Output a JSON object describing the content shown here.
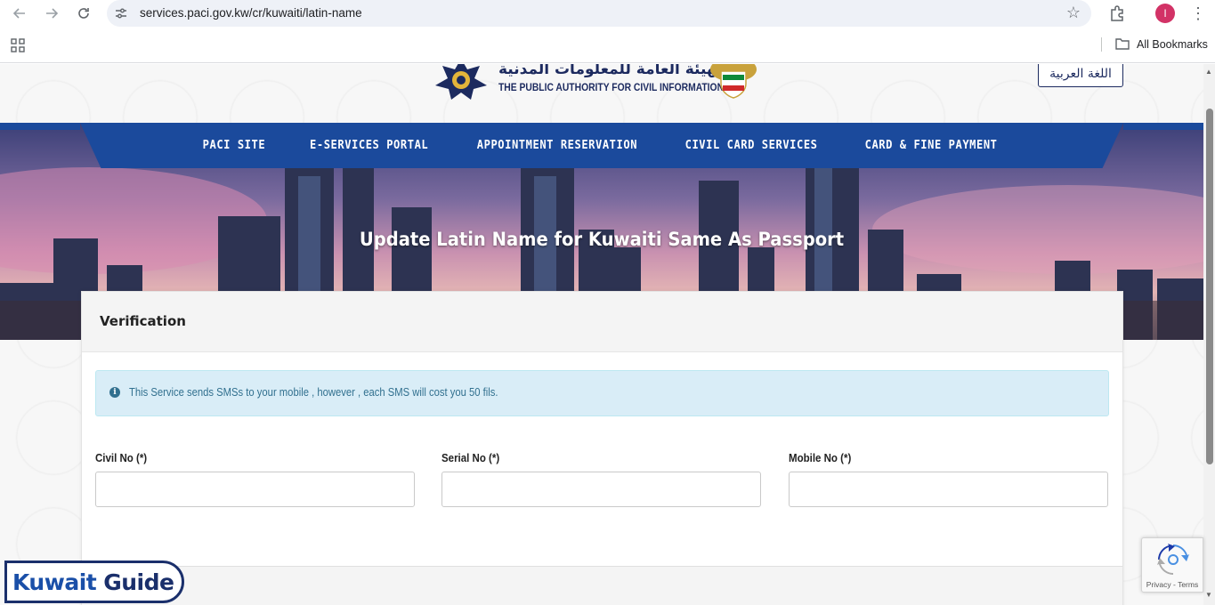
{
  "browser": {
    "url": "services.paci.gov.kw/cr/kuwaiti/latin-name",
    "profile_initial": "I",
    "bookmarks_label": "All Bookmarks"
  },
  "header": {
    "logo_arabic": "الهيئة العامة للمعلومات المدنية",
    "logo_english": "THE PUBLIC AUTHORITY FOR CIVIL INFORMATION",
    "language_button": "اللغة العربية"
  },
  "nav": {
    "items": [
      {
        "label": "PACI SITE"
      },
      {
        "label": "E-SERVICES PORTAL"
      },
      {
        "label": "APPOINTMENT RESERVATION"
      },
      {
        "label": "CIVIL CARD SERVICES"
      },
      {
        "label": "CARD & FINE PAYMENT"
      }
    ]
  },
  "hero": {
    "title": "Update Latin Name for Kuwaiti Same As Passport"
  },
  "card": {
    "title": "Verification",
    "alert": "This Service sends SMSs to your mobile , however , each SMS will cost you 50 fils.",
    "fields": [
      {
        "label": "Civil No (*)",
        "value": ""
      },
      {
        "label": "Serial No (*)",
        "value": ""
      },
      {
        "label": "Mobile No (*)",
        "value": ""
      }
    ]
  },
  "recaptcha": {
    "links": "Privacy - Terms"
  },
  "watermark": {
    "word1": "Kuwait",
    "word2": "Guide"
  },
  "colors": {
    "nav_bg": "#1b4a9c",
    "alert_bg": "#d9edf7",
    "alert_text": "#31708f",
    "brand_navy": "#1c2a5f"
  }
}
